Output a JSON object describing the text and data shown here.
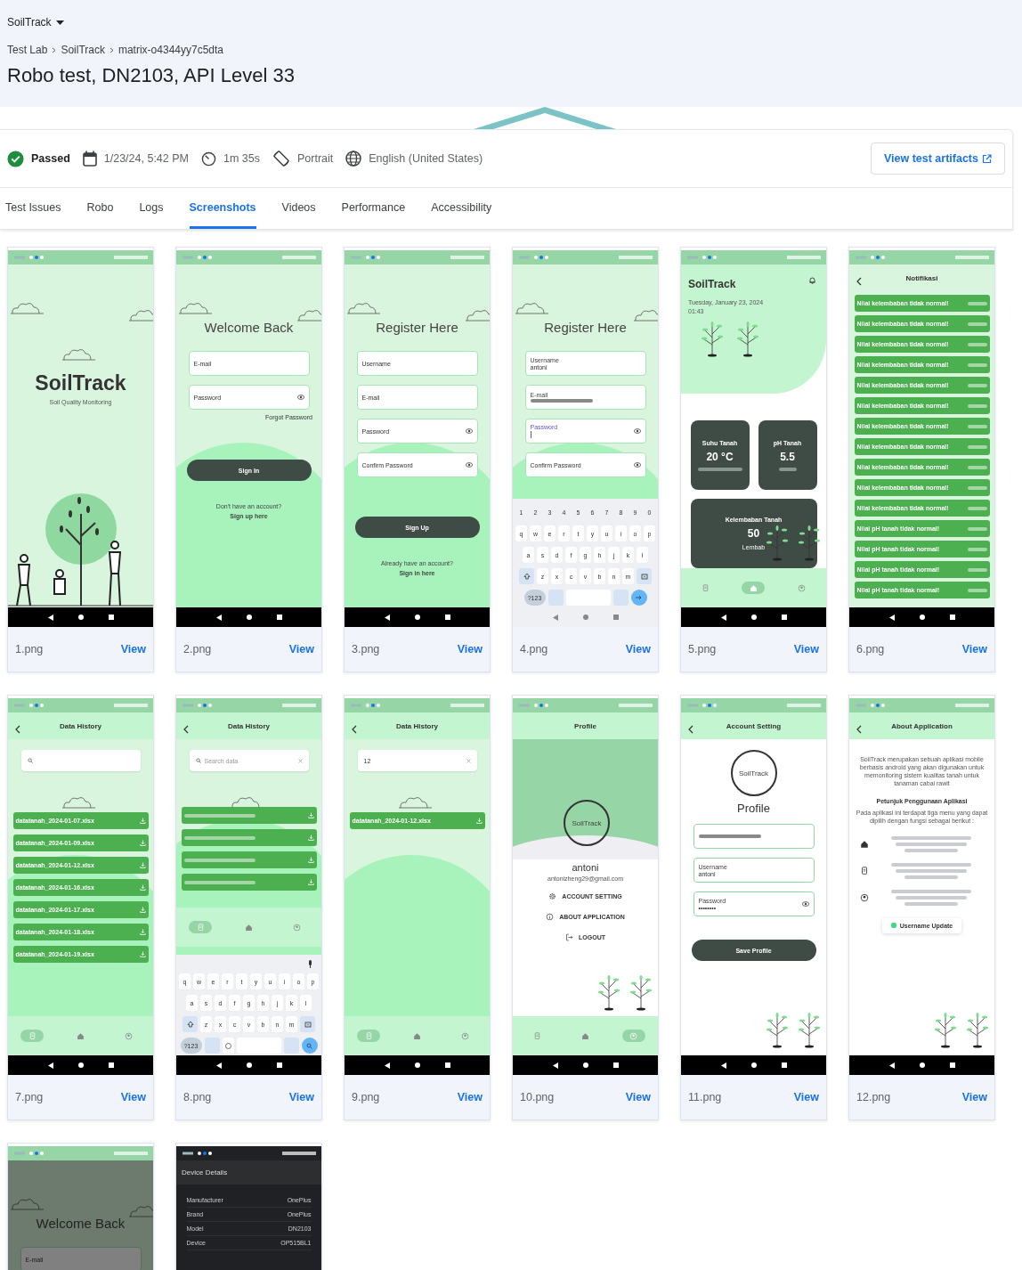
{
  "project": {
    "name": "SoilTrack"
  },
  "breadcrumbs": [
    "Test Lab",
    "SoilTrack",
    "matrix-o4344yy7c5dta"
  ],
  "title": "Robo test, DN2103, API Level 33",
  "info": {
    "status": {
      "kind": "passed",
      "label": "Passed"
    },
    "date": "1/23/24, 5:42 PM",
    "duration": "1m 35s",
    "orientation": "Portrait",
    "locale": "English (United States)",
    "artifacts_button": "View test artifacts"
  },
  "tabs": [
    {
      "label": "Test Issues",
      "selected": false
    },
    {
      "label": "Robo",
      "selected": false
    },
    {
      "label": "Logs",
      "selected": false
    },
    {
      "label": "Screenshots",
      "selected": true
    },
    {
      "label": "Videos",
      "selected": false
    },
    {
      "label": "Performance",
      "selected": false
    },
    {
      "label": "Accessibility",
      "selected": false
    }
  ],
  "screenshots": [
    {
      "file": "1.png",
      "action": "View",
      "kind": "splash",
      "logo": "SoilTrack",
      "subtitle": "Soil Quality Monitoring"
    },
    {
      "file": "2.png",
      "action": "View",
      "kind": "form",
      "title": "Welcome Back",
      "fields": [
        {
          "placeholder": "E-mail",
          "eye": false
        },
        {
          "placeholder": "Password",
          "eye": true
        }
      ],
      "link": "Forgot Password",
      "button": "Sign In",
      "footer": [
        "Don't have an account?",
        "Sign up here"
      ]
    },
    {
      "file": "3.png",
      "action": "View",
      "kind": "form",
      "title": "Register Here",
      "fields": [
        {
          "placeholder": "Username",
          "eye": false
        },
        {
          "placeholder": "E-mail",
          "eye": false
        },
        {
          "placeholder": "Password",
          "eye": true
        },
        {
          "placeholder": "Confirm Password",
          "eye": true
        }
      ],
      "button": "Sign Up",
      "footer": [
        "Already have an account?",
        "Sign in here"
      ]
    },
    {
      "file": "4.png",
      "action": "View",
      "kind": "form",
      "title": "Register Here",
      "fields": [
        {
          "label": "Username",
          "value": "antoni",
          "focused": false,
          "eye": false
        },
        {
          "label": "E-mail",
          "focused": false,
          "eye": false
        },
        {
          "label": "Password",
          "focused": true,
          "eye": true
        },
        {
          "placeholder": "Confirm Password",
          "focused": false,
          "eye": true
        }
      ],
      "keyboard": {
        "rows": [
          [
            "1",
            "2",
            "3",
            "4",
            "5",
            "6",
            "7",
            "8",
            "9",
            "0"
          ],
          [
            "q",
            "w",
            "e",
            "r",
            "t",
            "y",
            "u",
            "i",
            "o",
            "p"
          ],
          [
            "a",
            "s",
            "d",
            "f",
            "g",
            "h",
            "j",
            "k",
            "l"
          ],
          [
            "z",
            "x",
            "c",
            "v",
            "b",
            "n",
            "m"
          ]
        ],
        "symbols": "?123",
        "kind": "enter",
        "mic": false,
        "emoji": false
      }
    },
    {
      "file": "5.png",
      "action": "View",
      "kind": "dashboard",
      "logo": "SoilTrack",
      "date": "Tuesday, January 23, 2024",
      "time": "01:43",
      "cards": [
        {
          "title": "Suhu Tanah",
          "value": "20 °C"
        },
        {
          "title": "pH Tanah",
          "value": "5.5"
        },
        {
          "title": "Kelembaban Tanah",
          "value": "50",
          "status": "Lembab"
        }
      ],
      "tabs": [
        {
          "kind": "history",
          "selected": false
        },
        {
          "kind": "home",
          "selected": true
        },
        {
          "kind": "profile",
          "selected": false
        }
      ]
    },
    {
      "file": "6.png",
      "action": "View",
      "kind": "notifications",
      "title": "Notifikasi",
      "items": [
        {
          "text": "Nilai kelembaban tidak normal!"
        },
        {
          "text": "Nilai kelembaban tidak normal!"
        },
        {
          "text": "Nilai kelembaban tidak normal!"
        },
        {
          "text": "Nilai kelembaban tidak normal!"
        },
        {
          "text": "Nilai kelembaban tidak normal!"
        },
        {
          "text": "Nilai kelembaban tidak normal!"
        },
        {
          "text": "Nilai kelembaban tidak normal!"
        },
        {
          "text": "Nilai kelembaban tidak normal!"
        },
        {
          "text": "Nilai kelembaban tidak normal!"
        },
        {
          "text": "Nilai kelembaban tidak normal!"
        },
        {
          "text": "Nilai kelembaban tidak normal!"
        },
        {
          "text": "Nilai pH tanah tidak normal!"
        },
        {
          "text": "Nilai pH tanah tidak normal!"
        },
        {
          "text": "Nilai pH tanah tidak normal!"
        },
        {
          "text": "Nilai pH tanah tidak normal!"
        }
      ]
    },
    {
      "file": "7.png",
      "action": "View",
      "kind": "history",
      "title": "Data History",
      "search": {
        "clear": false
      },
      "files": [
        {
          "kind": "named",
          "name": "datatanah_2024-01-07.xlsx"
        },
        {
          "kind": "named",
          "name": "datatanah_2024-01-09.xlsx"
        },
        {
          "kind": "named",
          "name": "datatanah_2024-01-12.xlsx"
        },
        {
          "kind": "named",
          "name": "datatanah_2024-01-16.xlsx"
        },
        {
          "kind": "named",
          "name": "datatanah_2024-01-17.xlsx"
        },
        {
          "kind": "named",
          "name": "datatanah_2024-01-18.xlsx"
        },
        {
          "kind": "named",
          "name": "datatanah_2024-01-19.xlsx"
        }
      ],
      "tabs": [
        {
          "kind": "history",
          "selected": true
        },
        {
          "kind": "home",
          "selected": false
        },
        {
          "kind": "profile",
          "selected": false
        }
      ]
    },
    {
      "file": "8.png",
      "action": "View",
      "kind": "history",
      "title": "Data History",
      "search": {
        "placeholder": "Search data",
        "clear": true
      },
      "files": [
        {
          "kind": "blurred"
        },
        {
          "kind": "blurred"
        },
        {
          "kind": "blurred"
        },
        {
          "kind": "blurred"
        }
      ],
      "tabs": [
        {
          "kind": "history",
          "selected": true
        },
        {
          "kind": "home",
          "selected": false
        },
        {
          "kind": "profile",
          "selected": false
        }
      ],
      "keyboard": {
        "rows": [
          [
            "q",
            "w",
            "e",
            "r",
            "t",
            "y",
            "u",
            "i",
            "o",
            "p"
          ],
          [
            "a",
            "s",
            "d",
            "f",
            "g",
            "h",
            "j",
            "k",
            "l"
          ],
          [
            "z",
            "x",
            "c",
            "v",
            "b",
            "n",
            "m"
          ]
        ],
        "symbols": "?123",
        "kind": "search",
        "mic": true,
        "emoji": true
      }
    },
    {
      "file": "9.png",
      "action": "View",
      "kind": "history",
      "title": "Data History",
      "search": {
        "value": "12",
        "clear": true
      },
      "files": [
        {
          "kind": "named",
          "name": "datatanah_2024-01-12.xlsx"
        }
      ],
      "tabs": [
        {
          "kind": "history",
          "selected": true
        },
        {
          "kind": "home",
          "selected": false
        },
        {
          "kind": "profile",
          "selected": false
        }
      ]
    },
    {
      "file": "10.png",
      "action": "View",
      "kind": "profile",
      "title": "Profile",
      "logo": "SoilTrack",
      "name": "antoni",
      "email": "antonizheng29@gmail.com",
      "menu": [
        {
          "kind": "settings",
          "label": "ACCOUNT SETTING"
        },
        {
          "kind": "info",
          "label": "ABOUT APPLICATION"
        },
        {
          "kind": "logout",
          "label": "LOGOUT"
        }
      ],
      "tabs": [
        {
          "kind": "history",
          "selected": false
        },
        {
          "kind": "home",
          "selected": false
        },
        {
          "kind": "profile",
          "selected": true
        }
      ]
    },
    {
      "file": "11.png",
      "action": "View",
      "kind": "account",
      "title": "Account Setting",
      "logo": "SoilTrack",
      "heading": "Profile",
      "fields": [
        {
          "eye": false
        },
        {
          "label": "Username",
          "value": "antoni",
          "eye": false
        },
        {
          "label": "Password",
          "value": "••••••••",
          "eye": true
        }
      ],
      "button": "Save Profile"
    },
    {
      "file": "12.png",
      "action": "View",
      "kind": "about",
      "title": "About Application",
      "intro": "SoilTrack merupakan sebuah aplikasi mobile berbasis android yang akan digunakan untuk memonitoring sistem kualitas tanah untuk tanaman cabai rawit",
      "heading": "Petunjuk Penggunaan Aplikasi",
      "description": "Pada aplikasi ini terdapat tiga menu yang dapat dipilih dengan fungsi sebagai berikut :",
      "items": [
        {
          "kind": "home"
        },
        {
          "kind": "history"
        },
        {
          "kind": "profile"
        }
      ],
      "toast": "Username Update"
    },
    {
      "kind": "form",
      "dimmed": true,
      "title": "Welcome Back",
      "fields": [
        {
          "placeholder": "E-mail",
          "eye": false
        }
      ]
    },
    {
      "kind": "details",
      "title": "Device Details",
      "rows": [
        {
          "label": "Manufacturer",
          "value": "OnePlus"
        },
        {
          "label": "Brand",
          "value": "OnePlus"
        },
        {
          "label": "Model",
          "value": "DN2103"
        },
        {
          "label": "Device",
          "value": "OP515BL1"
        }
      ]
    }
  ]
}
